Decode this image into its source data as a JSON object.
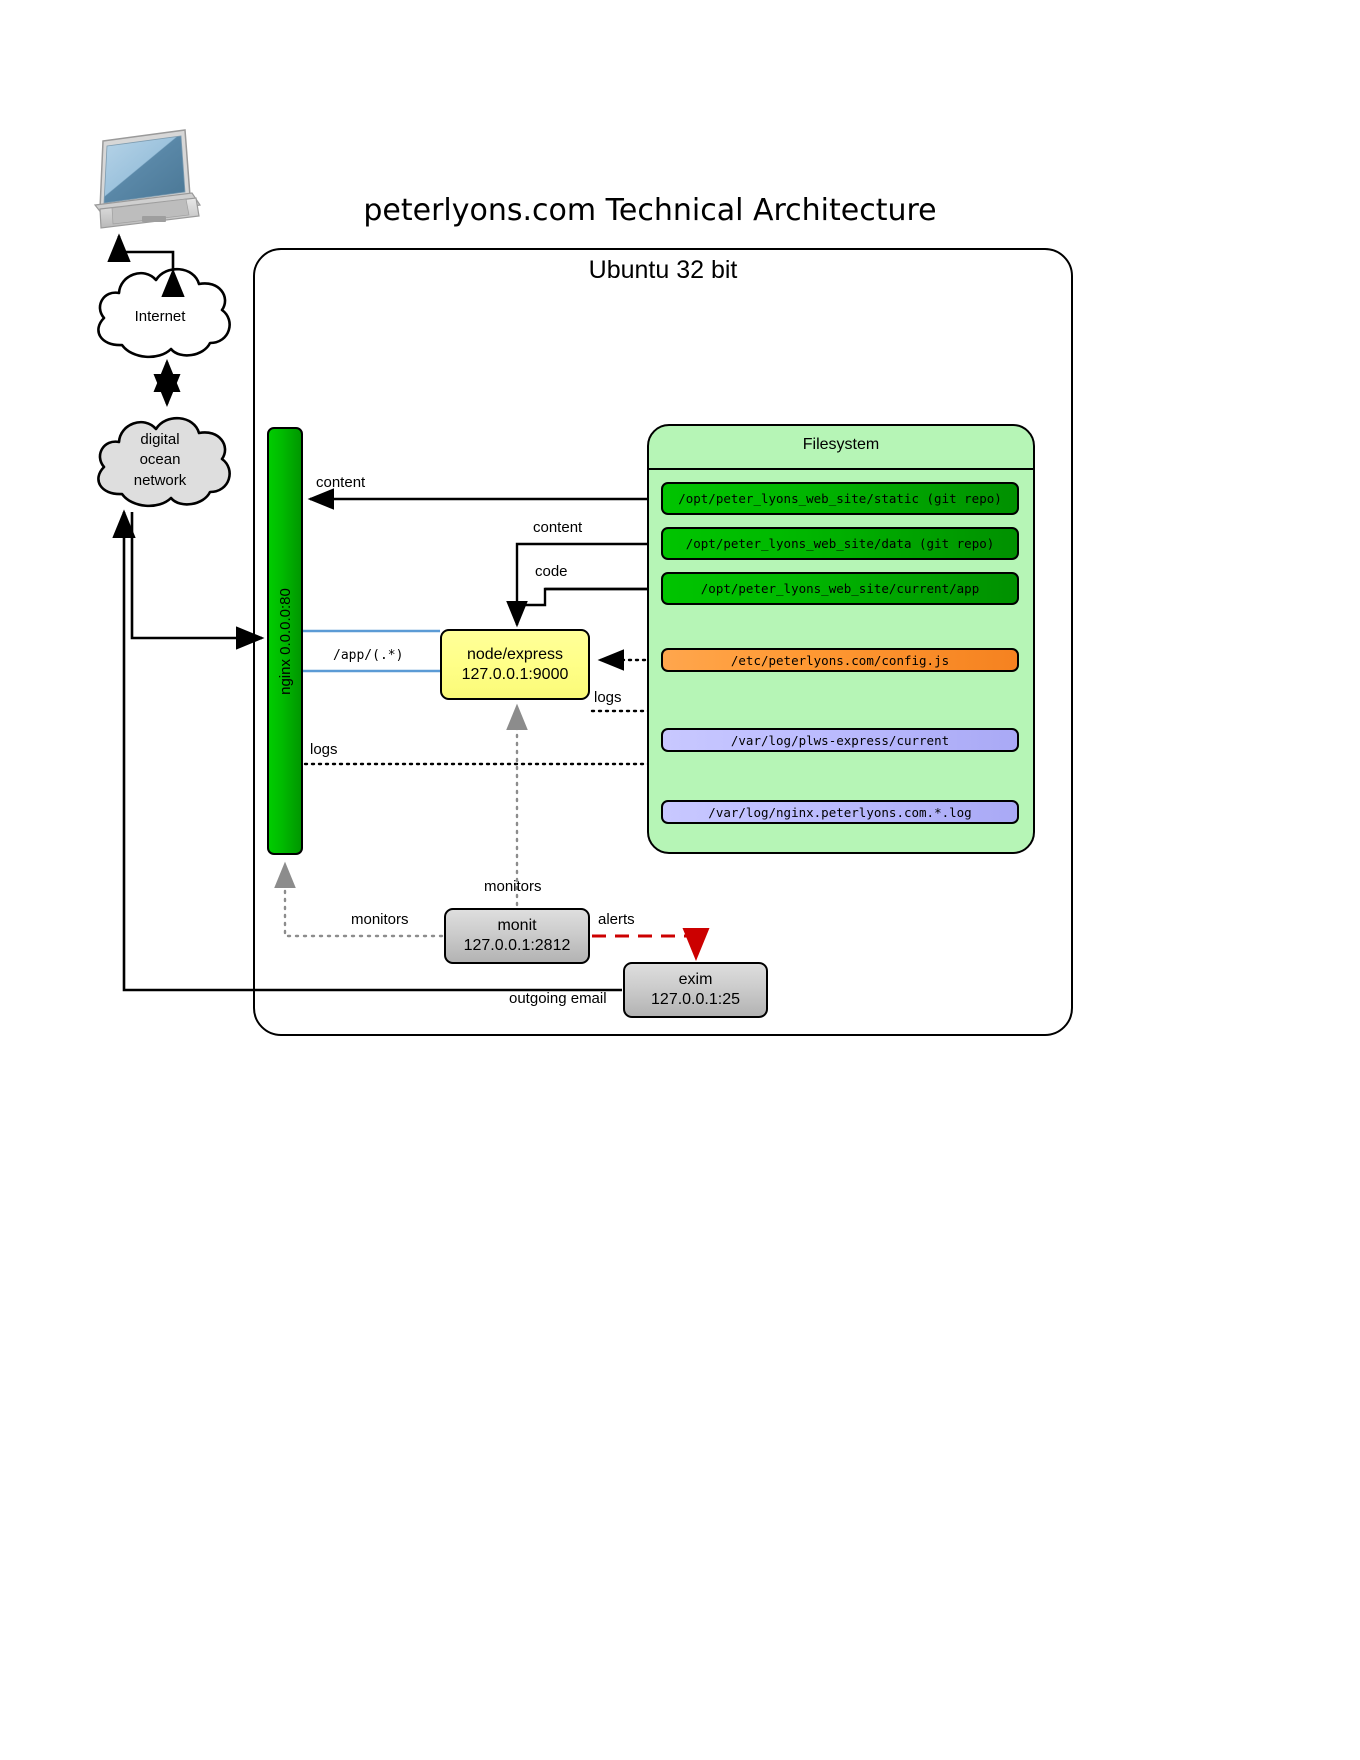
{
  "diagram": {
    "title": "peterlyons.com Technical Architecture",
    "host": {
      "label": "Ubuntu 32 bit"
    },
    "clouds": {
      "internet": "Internet",
      "digital_ocean_line1": "digital",
      "digital_ocean_line2": "ocean",
      "digital_ocean_line3": "network"
    },
    "client": {
      "icon": "laptop-icon"
    },
    "services": {
      "nginx": {
        "label": "nginx 0.0.0.0:80",
        "color": "#00aa00"
      },
      "node_express": {
        "name": "node/express",
        "address": "127.0.0.1:9000",
        "color": "#ffff99"
      },
      "monit": {
        "name": "monit",
        "address": "127.0.0.1:2812",
        "color": "#cccccc"
      },
      "exim": {
        "name": "exim",
        "address": "127.0.0.1:25",
        "color": "#cccccc"
      }
    },
    "filesystem": {
      "label": "Filesystem",
      "color": "#b6f5b6",
      "entries": [
        {
          "path": "/opt/peter_lyons_web_site/static (git repo)",
          "kind": "repo",
          "color": "#00b900"
        },
        {
          "path": "/opt/peter_lyons_web_site/data (git repo)",
          "kind": "repo",
          "color": "#00b900"
        },
        {
          "path": "/opt/peter_lyons_web_site/current/app",
          "kind": "code",
          "color": "#00b900"
        },
        {
          "path": "/etc/peterlyons.com/config.js",
          "kind": "config",
          "color": "#ff9933"
        },
        {
          "path": "/var/log/plws-express/current",
          "kind": "log",
          "color": "#bdbdff"
        },
        {
          "path": "/var/log/nginx.peterlyons.com.*.log",
          "kind": "log",
          "color": "#bdbdff"
        }
      ]
    },
    "edges": {
      "content_to_nginx": "content",
      "content_to_node": "content",
      "code_to_node": "code",
      "nginx_proxy_route": "/app/(.*)",
      "node_logs": "logs",
      "nginx_logs": "logs",
      "monit_monitors_node": "monitors",
      "monit_monitors_nginx": "monitors",
      "monit_alerts_exim": "alerts",
      "exim_outgoing": "outgoing email"
    }
  }
}
